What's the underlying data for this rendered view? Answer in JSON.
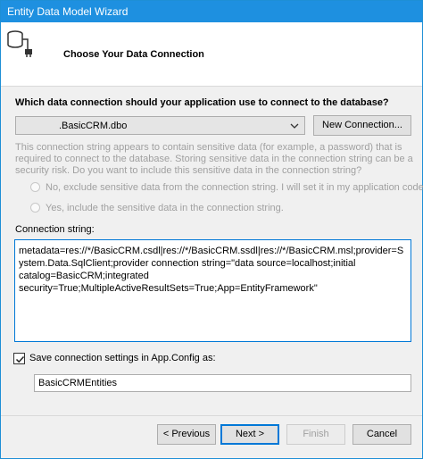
{
  "window": {
    "title": "Entity Data Model Wizard"
  },
  "header": {
    "heading": "Choose Your Data Connection",
    "icon": "database-connection-icon"
  },
  "question": "Which data connection should your application use to connect to the database?",
  "connection": {
    "selected": ".BasicCRM.dbo",
    "new_connection_label": "New Connection..."
  },
  "sensitive": {
    "text": "This connection string appears to contain sensitive data (for example, a password) that is required to connect to the database. Storing sensitive data in the connection string can be a security risk. Do you want to include this sensitive data in the connection string?",
    "option_no": "No, exclude sensitive data from the connection string. I will set it in my application code.",
    "option_yes": "Yes, include the sensitive data in the connection string."
  },
  "connection_string": {
    "label": "Connection string:",
    "value": "metadata=res://*/BasicCRM.csdl|res://*/BasicCRM.ssdl|res://*/BasicCRM.msl;provider=System.Data.SqlClient;provider connection string=\"data source=localhost;initial catalog=BasicCRM;integrated security=True;MultipleActiveResultSets=True;App=EntityFramework\""
  },
  "save_settings": {
    "checked": true,
    "label": "Save connection settings in App.Config as:",
    "value": "BasicCRMEntities"
  },
  "buttons": {
    "previous": "< Previous",
    "next": "Next >",
    "finish": "Finish",
    "cancel": "Cancel"
  },
  "colors": {
    "titlebar": "#1e90e0",
    "accent": "#0078d7",
    "disabled_text": "#a0a0a0"
  }
}
